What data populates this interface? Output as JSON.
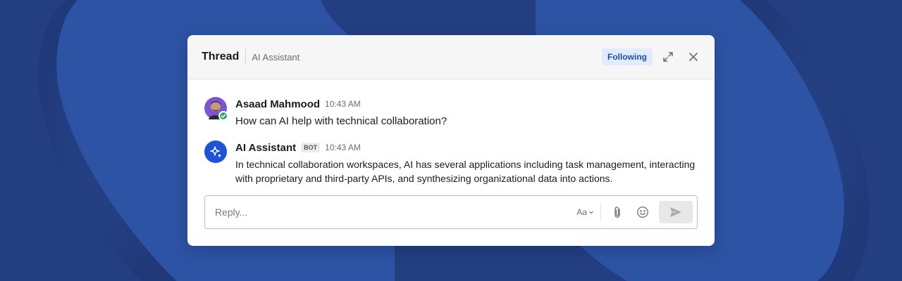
{
  "colors": {
    "background": "#233f82",
    "accent": "#1f52d8",
    "following_bg": "#e1ebfa",
    "status_green": "#2bac76"
  },
  "header": {
    "title": "Thread",
    "subtitle": "AI Assistant",
    "following_label": "Following",
    "expand_icon": "expand-icon",
    "close_icon": "close-icon"
  },
  "messages": [
    {
      "author": "Asaad Mahmood",
      "time": "10:43 AM",
      "text": "How can AI help with technical collaboration?",
      "avatar": "user-avatar",
      "status_icon": "check-icon"
    },
    {
      "author": "AI Assistant",
      "badge": "BOT",
      "time": "10:43 AM",
      "text": "In technical collaboration workspaces, AI has several applications including task management, interacting with proprietary and third-party APIs, and synthesizing organizational data into actions.",
      "avatar": "sparkle-icon"
    }
  ],
  "composer": {
    "placeholder": "Reply...",
    "format_label": "Aa",
    "attach_icon": "paperclip-icon",
    "emoji_icon": "smiley-icon",
    "send_icon": "send-icon"
  }
}
